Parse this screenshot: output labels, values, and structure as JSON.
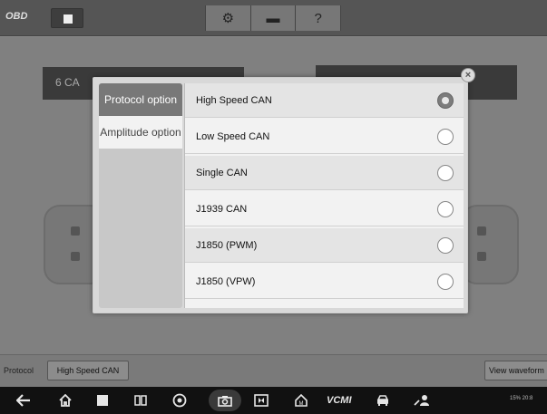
{
  "toolbar": {
    "logo": "OBD",
    "buttons": [
      "⚙",
      "▬",
      "?"
    ]
  },
  "background": {
    "panel_left_text": "6  CA"
  },
  "modal": {
    "tabs": [
      {
        "label": "Protocol option",
        "active": true
      },
      {
        "label": "Amplitude option",
        "active": false
      }
    ],
    "options": [
      {
        "label": "High Speed CAN",
        "selected": true
      },
      {
        "label": "Low Speed CAN",
        "selected": false
      },
      {
        "label": "Single CAN",
        "selected": false
      },
      {
        "label": "J1939 CAN",
        "selected": false
      },
      {
        "label": "J1850 (PWM)",
        "selected": false
      },
      {
        "label": "J1850 (VPW)",
        "selected": false
      }
    ],
    "close_label": "×"
  },
  "statusbar": {
    "protocol_label": "Protocol",
    "protocol_value": "High Speed CAN",
    "view_waveform": "View waveform"
  },
  "navbar": {
    "icons": [
      "back-icon",
      "home-icon",
      "recent-apps-icon",
      "multi-window-icon",
      "browser-icon",
      "camera-icon",
      "screen-record-icon",
      "maxifix-icon",
      "vcmi-icon",
      "car-icon",
      "service-icon"
    ],
    "vcmi_label": "VCMI",
    "tray_text": "15% 20:8"
  }
}
